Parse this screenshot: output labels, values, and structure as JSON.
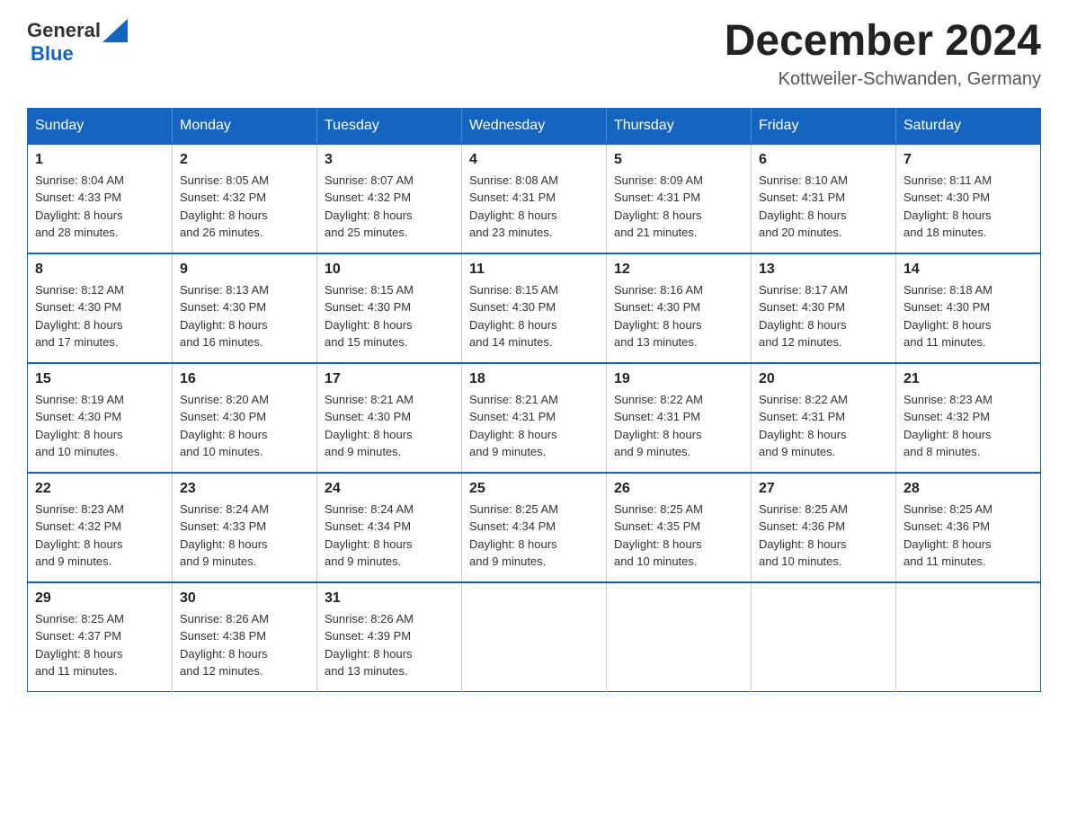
{
  "header": {
    "logo_text_general": "General",
    "logo_text_blue": "Blue",
    "month_title": "December 2024",
    "location": "Kottweiler-Schwanden, Germany"
  },
  "days_of_week": [
    "Sunday",
    "Monday",
    "Tuesday",
    "Wednesday",
    "Thursday",
    "Friday",
    "Saturday"
  ],
  "weeks": [
    [
      {
        "day": "1",
        "sunrise": "8:04 AM",
        "sunset": "4:33 PM",
        "daylight": "8 hours and 28 minutes."
      },
      {
        "day": "2",
        "sunrise": "8:05 AM",
        "sunset": "4:32 PM",
        "daylight": "8 hours and 26 minutes."
      },
      {
        "day": "3",
        "sunrise": "8:07 AM",
        "sunset": "4:32 PM",
        "daylight": "8 hours and 25 minutes."
      },
      {
        "day": "4",
        "sunrise": "8:08 AM",
        "sunset": "4:31 PM",
        "daylight": "8 hours and 23 minutes."
      },
      {
        "day": "5",
        "sunrise": "8:09 AM",
        "sunset": "4:31 PM",
        "daylight": "8 hours and 21 minutes."
      },
      {
        "day": "6",
        "sunrise": "8:10 AM",
        "sunset": "4:31 PM",
        "daylight": "8 hours and 20 minutes."
      },
      {
        "day": "7",
        "sunrise": "8:11 AM",
        "sunset": "4:30 PM",
        "daylight": "8 hours and 18 minutes."
      }
    ],
    [
      {
        "day": "8",
        "sunrise": "8:12 AM",
        "sunset": "4:30 PM",
        "daylight": "8 hours and 17 minutes."
      },
      {
        "day": "9",
        "sunrise": "8:13 AM",
        "sunset": "4:30 PM",
        "daylight": "8 hours and 16 minutes."
      },
      {
        "day": "10",
        "sunrise": "8:15 AM",
        "sunset": "4:30 PM",
        "daylight": "8 hours and 15 minutes."
      },
      {
        "day": "11",
        "sunrise": "8:15 AM",
        "sunset": "4:30 PM",
        "daylight": "8 hours and 14 minutes."
      },
      {
        "day": "12",
        "sunrise": "8:16 AM",
        "sunset": "4:30 PM",
        "daylight": "8 hours and 13 minutes."
      },
      {
        "day": "13",
        "sunrise": "8:17 AM",
        "sunset": "4:30 PM",
        "daylight": "8 hours and 12 minutes."
      },
      {
        "day": "14",
        "sunrise": "8:18 AM",
        "sunset": "4:30 PM",
        "daylight": "8 hours and 11 minutes."
      }
    ],
    [
      {
        "day": "15",
        "sunrise": "8:19 AM",
        "sunset": "4:30 PM",
        "daylight": "8 hours and 10 minutes."
      },
      {
        "day": "16",
        "sunrise": "8:20 AM",
        "sunset": "4:30 PM",
        "daylight": "8 hours and 10 minutes."
      },
      {
        "day": "17",
        "sunrise": "8:21 AM",
        "sunset": "4:30 PM",
        "daylight": "8 hours and 9 minutes."
      },
      {
        "day": "18",
        "sunrise": "8:21 AM",
        "sunset": "4:31 PM",
        "daylight": "8 hours and 9 minutes."
      },
      {
        "day": "19",
        "sunrise": "8:22 AM",
        "sunset": "4:31 PM",
        "daylight": "8 hours and 9 minutes."
      },
      {
        "day": "20",
        "sunrise": "8:22 AM",
        "sunset": "4:31 PM",
        "daylight": "8 hours and 9 minutes."
      },
      {
        "day": "21",
        "sunrise": "8:23 AM",
        "sunset": "4:32 PM",
        "daylight": "8 hours and 8 minutes."
      }
    ],
    [
      {
        "day": "22",
        "sunrise": "8:23 AM",
        "sunset": "4:32 PM",
        "daylight": "8 hours and 9 minutes."
      },
      {
        "day": "23",
        "sunrise": "8:24 AM",
        "sunset": "4:33 PM",
        "daylight": "8 hours and 9 minutes."
      },
      {
        "day": "24",
        "sunrise": "8:24 AM",
        "sunset": "4:34 PM",
        "daylight": "8 hours and 9 minutes."
      },
      {
        "day": "25",
        "sunrise": "8:25 AM",
        "sunset": "4:34 PM",
        "daylight": "8 hours and 9 minutes."
      },
      {
        "day": "26",
        "sunrise": "8:25 AM",
        "sunset": "4:35 PM",
        "daylight": "8 hours and 10 minutes."
      },
      {
        "day": "27",
        "sunrise": "8:25 AM",
        "sunset": "4:36 PM",
        "daylight": "8 hours and 10 minutes."
      },
      {
        "day": "28",
        "sunrise": "8:25 AM",
        "sunset": "4:36 PM",
        "daylight": "8 hours and 11 minutes."
      }
    ],
    [
      {
        "day": "29",
        "sunrise": "8:25 AM",
        "sunset": "4:37 PM",
        "daylight": "8 hours and 11 minutes."
      },
      {
        "day": "30",
        "sunrise": "8:26 AM",
        "sunset": "4:38 PM",
        "daylight": "8 hours and 12 minutes."
      },
      {
        "day": "31",
        "sunrise": "8:26 AM",
        "sunset": "4:39 PM",
        "daylight": "8 hours and 13 minutes."
      },
      null,
      null,
      null,
      null
    ]
  ],
  "labels": {
    "sunrise": "Sunrise:",
    "sunset": "Sunset:",
    "daylight": "Daylight:"
  }
}
